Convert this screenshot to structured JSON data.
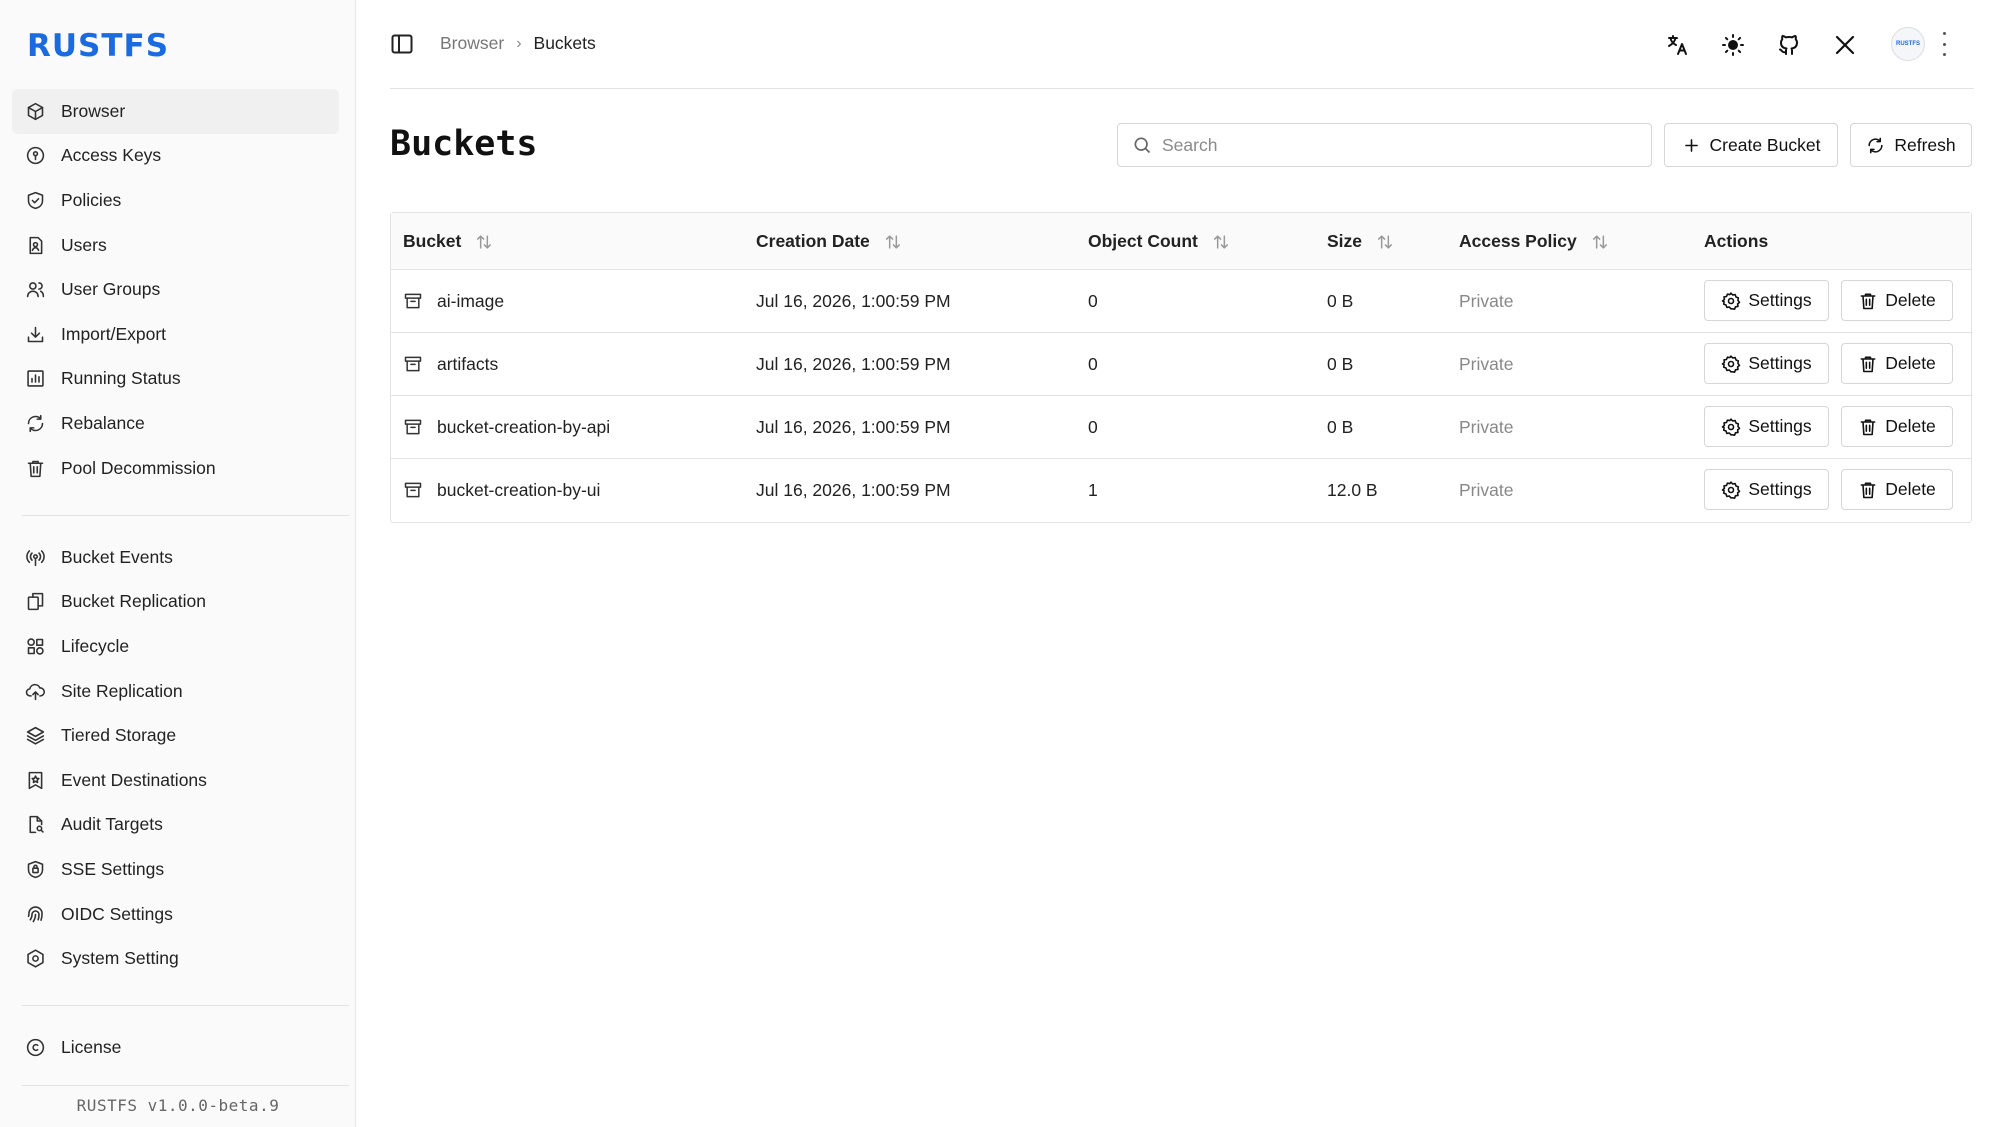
{
  "app": {
    "logo": "RUSTFS",
    "version": "RUSTFS v1.0.0-beta.9",
    "avatar_text": "RUSTFS"
  },
  "sidebar": {
    "group1": [
      {
        "label": "Browser",
        "icon": "box-icon",
        "active": true
      },
      {
        "label": "Access Keys",
        "icon": "key-circle-icon"
      },
      {
        "label": "Policies",
        "icon": "shield-check-icon"
      },
      {
        "label": "Users",
        "icon": "user-badge-icon"
      },
      {
        "label": "User Groups",
        "icon": "users-icon"
      },
      {
        "label": "Import/Export",
        "icon": "download-icon"
      },
      {
        "label": "Running Status",
        "icon": "bar-chart-icon"
      },
      {
        "label": "Rebalance",
        "icon": "refresh-icon"
      },
      {
        "label": "Pool Decommission",
        "icon": "trash-icon"
      }
    ],
    "group2": [
      {
        "label": "Bucket Events",
        "icon": "broadcast-icon"
      },
      {
        "label": "Bucket Replication",
        "icon": "copy-icon"
      },
      {
        "label": "Lifecycle",
        "icon": "lifecycle-icon"
      },
      {
        "label": "Site Replication",
        "icon": "cloud-upload-icon"
      },
      {
        "label": "Tiered Storage",
        "icon": "layers-icon"
      },
      {
        "label": "Event Destinations",
        "icon": "bookmark-star-icon"
      },
      {
        "label": "Audit Targets",
        "icon": "file-search-icon"
      },
      {
        "label": "SSE Settings",
        "icon": "lock-shield-icon"
      },
      {
        "label": "OIDC Settings",
        "icon": "fingerprint-icon"
      },
      {
        "label": "System Setting",
        "icon": "settings-hex-icon"
      }
    ],
    "group3": [
      {
        "label": "License",
        "icon": "copyright-icon"
      }
    ]
  },
  "breadcrumb": {
    "parent": "Browser",
    "current": "Buckets"
  },
  "header_icons": [
    "translate-icon",
    "sun-icon",
    "github-icon",
    "x-logo-icon"
  ],
  "page": {
    "title": "Buckets",
    "search_placeholder": "Search",
    "create_label": "Create Bucket",
    "refresh_label": "Refresh"
  },
  "table": {
    "columns": [
      "Bucket",
      "Creation Date",
      "Object Count",
      "Size",
      "Access Policy",
      "Actions"
    ],
    "settings_label": "Settings",
    "delete_label": "Delete",
    "rows": [
      {
        "name": "ai-image",
        "date": "Jul 16, 2026, 1:00:59 PM",
        "count": "0",
        "size": "0 B",
        "policy": "Private"
      },
      {
        "name": "artifacts",
        "date": "Jul 16, 2026, 1:00:59 PM",
        "count": "0",
        "size": "0 B",
        "policy": "Private"
      },
      {
        "name": "bucket-creation-by-api",
        "date": "Jul 16, 2026, 1:00:59 PM",
        "count": "0",
        "size": "0 B",
        "policy": "Private"
      },
      {
        "name": "bucket-creation-by-ui",
        "date": "Jul 16, 2026, 1:00:59 PM",
        "count": "1",
        "size": "12.0 B",
        "policy": "Private"
      }
    ]
  },
  "colors": {
    "brand": "#1b6ae0",
    "muted_text": "#888888",
    "border": "#e3e3e3"
  }
}
